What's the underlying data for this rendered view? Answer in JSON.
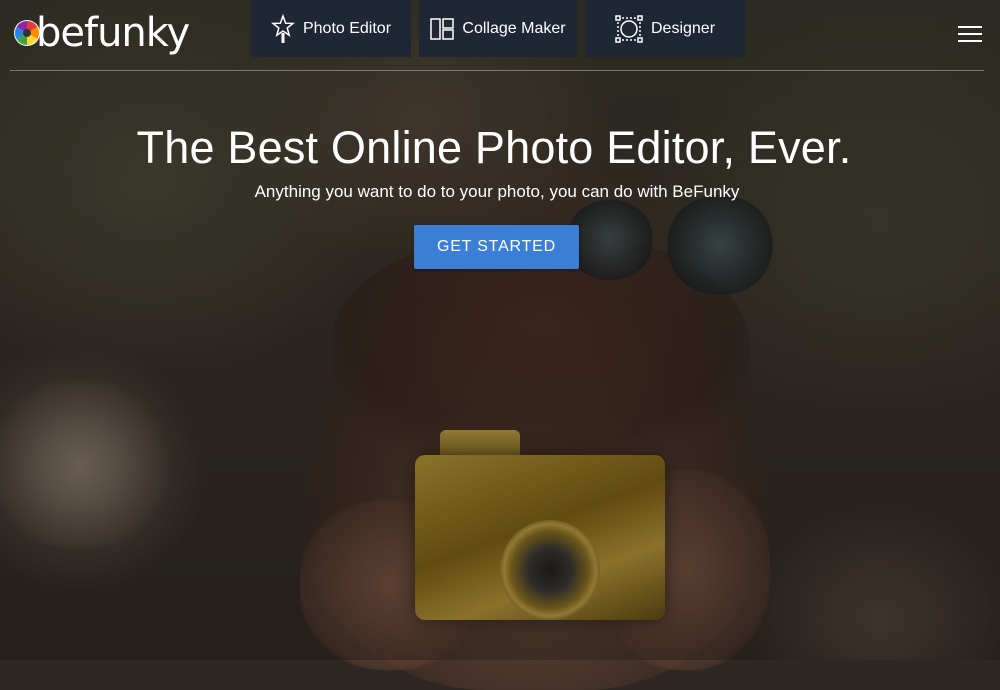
{
  "brand": {
    "name": "befunky",
    "logo_icon": "color-wheel-icon"
  },
  "nav": {
    "tabs": [
      {
        "label": "Photo Editor",
        "icon": "star-wand-icon"
      },
      {
        "label": "Collage Maker",
        "icon": "collage-grid-icon"
      },
      {
        "label": "Designer",
        "icon": "designer-frame-icon"
      }
    ],
    "menu_icon": "hamburger-menu-icon"
  },
  "hero": {
    "title": "The Best Online Photo Editor, Ever.",
    "subtitle": "Anything you want to do to your photo, you can do with BeFunky",
    "cta_label": "GET STARTED",
    "cta_color": "#3a7fd5"
  },
  "colors": {
    "nav_tab_bg": "#1f2735",
    "text": "#ffffff"
  }
}
